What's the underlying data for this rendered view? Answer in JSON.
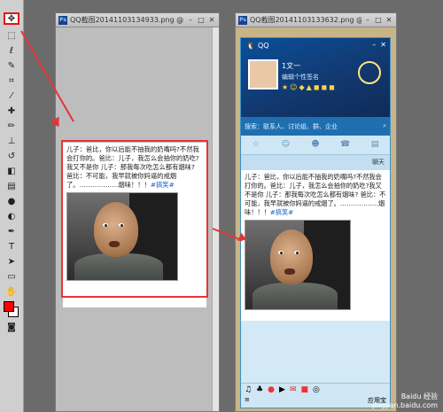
{
  "toolbar": {
    "tools": [
      "move-tool",
      "marquee-tool",
      "lasso-tool",
      "quick-select-tool",
      "crop-tool",
      "eyedropper-tool",
      "healing-tool",
      "brush-tool",
      "stamp-tool",
      "history-brush-tool",
      "eraser-tool",
      "gradient-tool",
      "blur-tool",
      "dodge-tool",
      "pen-tool",
      "type-tool",
      "path-select-tool",
      "shape-tool",
      "hand-tool",
      "zoom-tool"
    ],
    "colors": {
      "foreground": "#ff0000",
      "background": "#ffffff"
    }
  },
  "left_window": {
    "title": "QQ截图20141103134933.png @ 100..."
  },
  "right_window": {
    "title": "QQ截图20141103133632.png @ 100..."
  },
  "post": {
    "text": "儿子：爸比，你以后能不抽我的奶嘴吗?不然我会打你的。爸比：儿子，我怎么会抽你的奶吃?我又不是你 儿子：那我每次吃怎么都有烟味? 爸比：不可能，我早就被你妈逼的戒烟了。………………烟味！！！",
    "hashtag": "#搞笑#"
  },
  "qq": {
    "app_name": "QQ",
    "username": "1文一",
    "signature": "编辑个性签名",
    "search_placeholder": "搜索：联系人、讨论组、群、企业",
    "chat_label": "聊天",
    "app_store": "应用宝"
  },
  "watermark": {
    "brand": "Baidu 经验",
    "url": "jingyan.baidu.com"
  }
}
